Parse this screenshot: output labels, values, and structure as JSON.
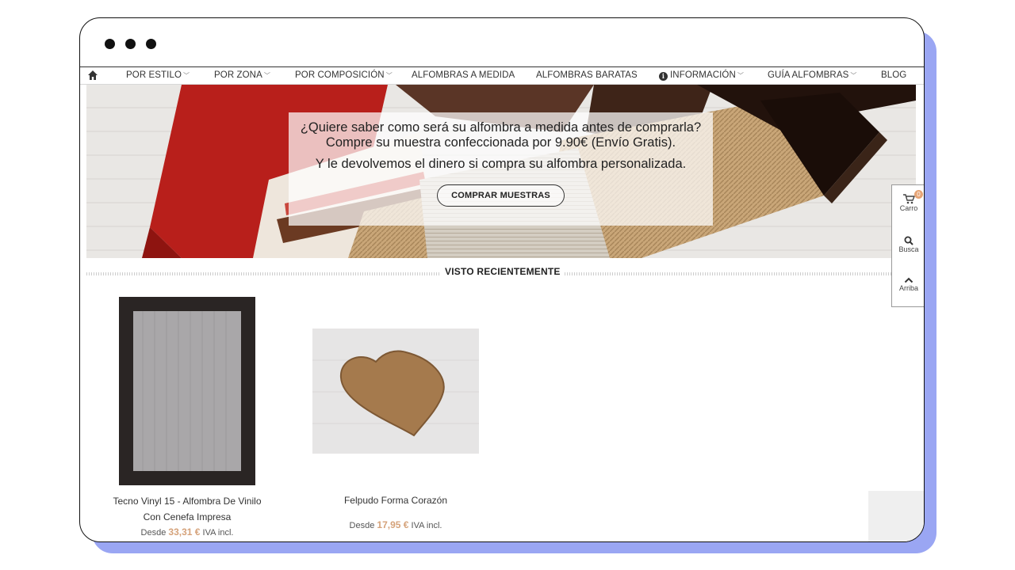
{
  "nav": {
    "items": [
      {
        "label": "POR ESTILO",
        "dropdown": true
      },
      {
        "label": "POR ZONA",
        "dropdown": true
      },
      {
        "label": "POR COMPOSICIÓN",
        "dropdown": true
      },
      {
        "label": "ALFOMBRAS A MEDIDA",
        "dropdown": false
      },
      {
        "label": "ALFOMBRAS BARATAS",
        "dropdown": false
      },
      {
        "label": "INFORMACIÓN",
        "dropdown": true,
        "icon": "info-icon"
      },
      {
        "label": "GUÍA ALFOMBRAS",
        "dropdown": true
      },
      {
        "label": "BLOG",
        "dropdown": false
      }
    ]
  },
  "hero": {
    "line1": "¿Quiere saber como será su alfombra a medida antes de comprarla?",
    "line2": "Compre su muestra confeccionada por 9.90€ (Envío Gratis).",
    "line3": "Y le devolvemos el dinero si compra su alfombra personalizada.",
    "button": "COMPRAR MUESTRAS"
  },
  "section": {
    "title": "VISTO RECIENTEMENTE"
  },
  "products": [
    {
      "name_line1": "Tecno Vinyl 15 - Alfombra De Vinilo",
      "name_line2": "Con Cenefa Impresa",
      "price_prefix": "Desde",
      "price": "33,31 €",
      "price_suffix": "IVA incl."
    },
    {
      "name_line1": "Felpudo Forma Corazón",
      "name_line2": "",
      "price_prefix": "Desde",
      "price": "17,95 €",
      "price_suffix": "IVA incl."
    }
  ],
  "side": {
    "cart_label": "Carro",
    "cart_count": "0",
    "search_label": "Busca",
    "top_label": "Arriba"
  },
  "colors": {
    "accent_price": "#d5a27a",
    "frame_shadow": "#9aa6f3"
  }
}
